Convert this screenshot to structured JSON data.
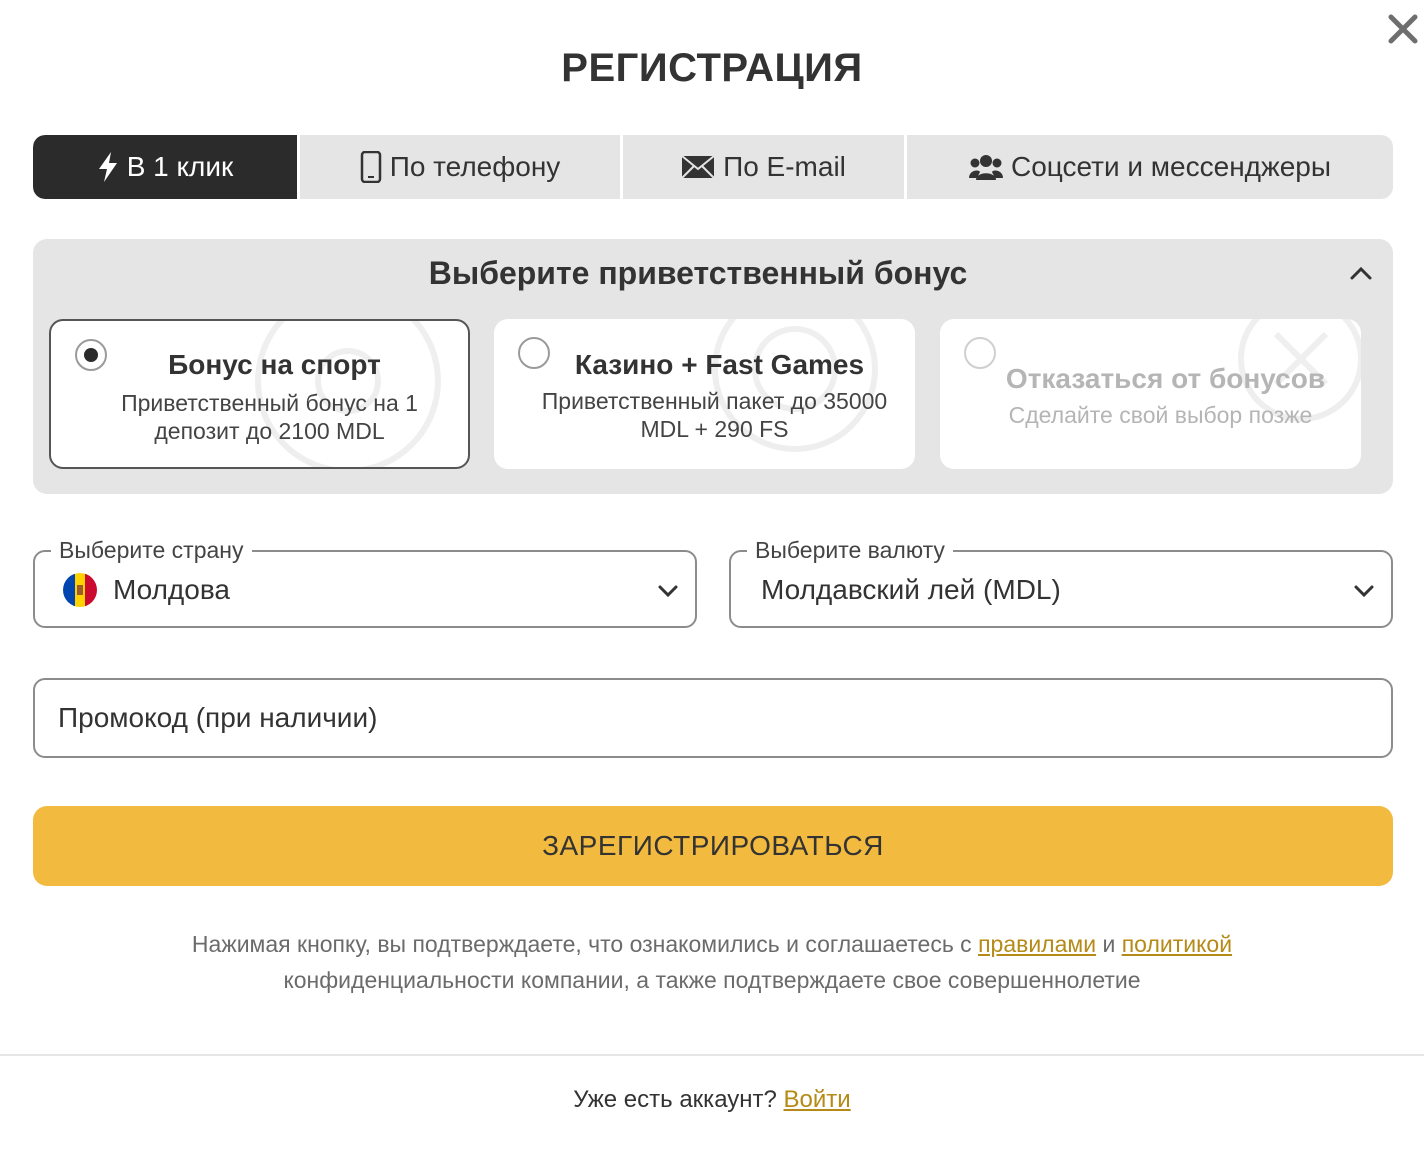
{
  "dialog": {
    "title": "РЕГИСТРАЦИЯ",
    "close_icon": "close-icon"
  },
  "tabs": [
    {
      "label": "В 1 клик",
      "icon": "lightning-icon",
      "active": true
    },
    {
      "label": "По телефону",
      "icon": "phone-icon",
      "active": false
    },
    {
      "label": "По E-mail",
      "icon": "envelope-icon",
      "active": false
    },
    {
      "label": "Соцсети и мессенджеры",
      "icon": "users-icon",
      "active": false
    }
  ],
  "bonus": {
    "heading": "Выберите приветственный бонус",
    "toggle_icon": "chevron-up-icon",
    "options": [
      {
        "title": "Бонус на спорт",
        "description": "Приветственный бонус на 1 депозит до 2100 MDL",
        "selected": true
      },
      {
        "title": "Казино + Fast Games",
        "description": "Приветственный пакет до 35000 MDL + 290 FS",
        "selected": false
      },
      {
        "title": "Отказаться от бонусов",
        "description": "Сделайте свой выбор позже",
        "selected": false
      }
    ]
  },
  "country": {
    "label": "Выберите страну",
    "value": "Молдова",
    "flag_icon": "moldova-flag-icon"
  },
  "currency": {
    "label": "Выберите валюту",
    "value": "Молдавский лей (MDL)"
  },
  "promo": {
    "placeholder": "Промокод (при наличии)",
    "value": ""
  },
  "submit_label": "ЗАРЕГИСТРИРОВАТЬСЯ",
  "terms": {
    "part1": "Нажимая кнопку, вы подтверждаете, что ознакомились и соглашаетесь с ",
    "rules_link": "правилами",
    "part2": " и ",
    "policy_link": "политикой",
    "part3": "конфиденциальности компании, а также подтверждаете свое совершеннолетие"
  },
  "footer": {
    "text": "Уже есть аккаунт? ",
    "login_link": "Войти"
  },
  "colors": {
    "accent": "#f2bb3f",
    "active_tab": "#2b2b2b",
    "link": "#b58a17",
    "panel_bg": "#e5e5e5"
  }
}
